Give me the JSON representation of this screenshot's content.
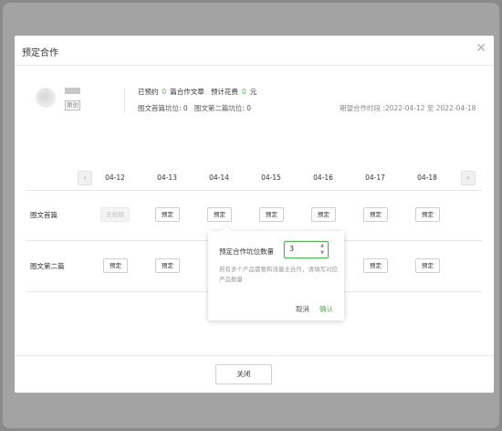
{
  "dialog": {
    "title": "预定合作",
    "close_icon": "close-icon"
  },
  "summary": {
    "avatar_icon": "avatar-icon",
    "tag": "原创",
    "booked_label": "已预约",
    "booked_count": "0",
    "articles_label": "篇合作文章",
    "cost_label": "预计花费",
    "cost_value": "0",
    "cost_unit": "元",
    "first_slot": "图文首篇坑位: 0",
    "second_slot": "图文第二篇坑位: 0",
    "period": "期望合作时段 :2022-04-12  至  2022-04-18"
  },
  "calendar": {
    "prev_icon": "chevron-left-icon",
    "next_icon": "chevron-right-icon",
    "dates": [
      "04-12",
      "04-13",
      "04-14",
      "04-15",
      "04-16",
      "04-17",
      "04-18"
    ],
    "rows": [
      {
        "label": "图文首篇",
        "cells": [
          "无档期",
          "预定",
          "预定",
          "预定",
          "预定",
          "预定",
          "预定"
        ]
      },
      {
        "label": "图文第二篇",
        "cells": [
          "预定",
          "预定",
          "",
          "",
          "",
          "预定",
          "预定"
        ]
      }
    ]
  },
  "popover": {
    "label": "预定合作坑位数量",
    "value": "3",
    "help": "若有多个产品需要和流量主合作，请填写对应产品数量",
    "cancel": "取消",
    "confirm": "确认"
  },
  "footer": {
    "close_label": "关闭"
  },
  "colors": {
    "accent": "#52b34f",
    "overlay": "#a3a3a3"
  }
}
